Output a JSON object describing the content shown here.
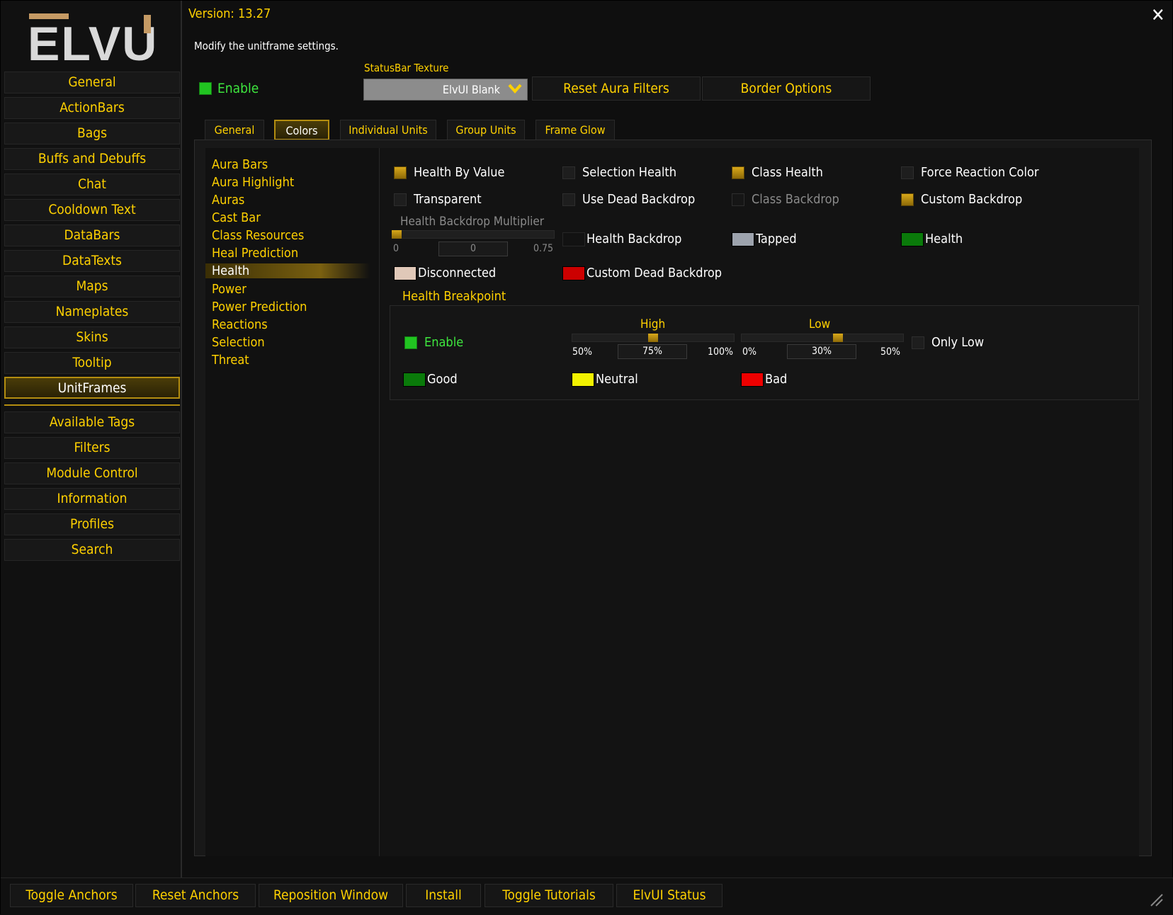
{
  "header": {
    "version": "Version: 13.27",
    "description": "Modify the unitframe settings.",
    "close_glyph": "✕"
  },
  "nav": {
    "logo_text": "ELVU",
    "items": [
      "General",
      "ActionBars",
      "Bags",
      "Buffs and Debuffs",
      "Chat",
      "Cooldown Text",
      "DataBars",
      "DataTexts",
      "Maps",
      "Nameplates",
      "Skins",
      "Tooltip",
      "UnitFrames"
    ],
    "active": "UnitFrames",
    "utility_items": [
      "Available Tags",
      "Filters",
      "Module Control",
      "Information",
      "Profiles",
      "Search"
    ]
  },
  "top": {
    "enable_label": "Enable",
    "statusbar_label": "StatusBar Texture",
    "statusbar_value": "ElvUI Blank",
    "reset_aura_filters": "Reset Aura Filters",
    "border_options": "Border Options"
  },
  "tabs": [
    "General",
    "Colors",
    "Individual Units",
    "Group Units",
    "Frame Glow"
  ],
  "active_tab": "Colors",
  "subnav": {
    "items": [
      "Aura Bars",
      "Aura Highlight",
      "Auras",
      "Cast Bar",
      "Class Resources",
      "Heal Prediction",
      "Health",
      "Power",
      "Power Prediction",
      "Reactions",
      "Selection",
      "Threat"
    ],
    "active": "Health"
  },
  "health": {
    "toggles": [
      {
        "label": "Health By Value",
        "checked": true,
        "disabled": false
      },
      {
        "label": "Selection Health",
        "checked": false,
        "disabled": false
      },
      {
        "label": "Class Health",
        "checked": true,
        "disabled": false
      },
      {
        "label": "Force Reaction Color",
        "checked": false,
        "disabled": false
      },
      {
        "label": "Transparent",
        "checked": false,
        "disabled": false
      },
      {
        "label": "Use Dead Backdrop",
        "checked": false,
        "disabled": false
      },
      {
        "label": "Class Backdrop",
        "checked": false,
        "disabled": true
      },
      {
        "label": "Custom Backdrop",
        "checked": true,
        "disabled": false
      }
    ],
    "multiplier": {
      "label": "Health Backdrop Multiplier",
      "min": "0",
      "max": "0.75",
      "value": "0",
      "fraction": 0.0
    },
    "colors": [
      {
        "label": "Health Backdrop",
        "color": "#121212"
      },
      {
        "label": "Tapped",
        "color": "#9da3ad"
      },
      {
        "label": "Health",
        "color": "#0a7a0a"
      },
      {
        "label": "Disconnected",
        "color": "#e0c8b8"
      },
      {
        "label": "Custom Dead Backdrop",
        "color": "#cc0000"
      }
    ],
    "breakpoint": {
      "title": "Health Breakpoint",
      "enable_label": "Enable",
      "high": {
        "label": "High",
        "min": "50%",
        "max": "100%",
        "value": "75%",
        "fraction": 0.5
      },
      "low": {
        "label": "Low",
        "min": "0%",
        "max": "50%",
        "value": "30%",
        "fraction": 0.6
      },
      "only_low": "Only Low",
      "colors": [
        {
          "label": "Good",
          "color": "#0a7a0a"
        },
        {
          "label": "Neutral",
          "color": "#f2f200"
        },
        {
          "label": "Bad",
          "color": "#ee0000"
        }
      ]
    }
  },
  "bottom": [
    "Toggle Anchors",
    "Reset Anchors",
    "Reposition Window",
    "Install",
    "Toggle Tutorials",
    "ElvUI Status"
  ]
}
